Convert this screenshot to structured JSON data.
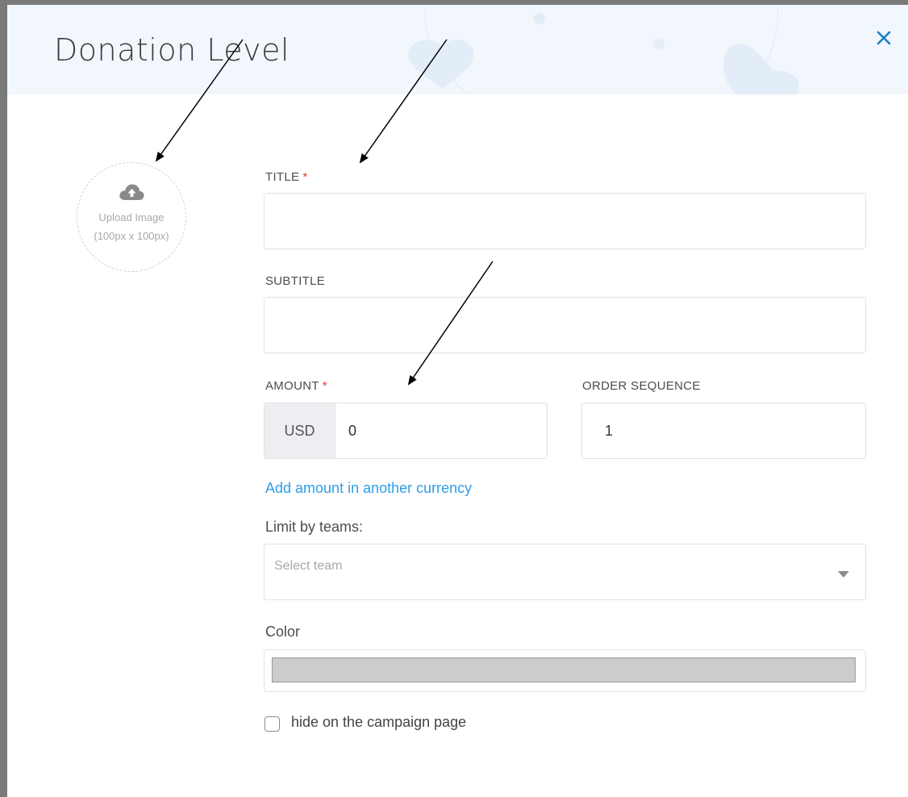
{
  "modal": {
    "title": "Donation Level",
    "close_icon": "close-icon"
  },
  "upload": {
    "icon": "cloud-upload-icon",
    "label": "Upload Image",
    "size_hint": "(100px x 100px)"
  },
  "form": {
    "title": {
      "label": "TITLE",
      "required_mark": "*",
      "value": ""
    },
    "subtitle": {
      "label": "SUBTITLE",
      "value": ""
    },
    "amount": {
      "label": "AMOUNT",
      "required_mark": "*",
      "currency": "USD",
      "value": "0"
    },
    "order_sequence": {
      "label": "ORDER SEQUENCE",
      "value": "1"
    },
    "add_currency_link": "Add amount in another currency",
    "limit_by_teams": {
      "label": "Limit by teams:",
      "placeholder": "Select team",
      "icon": "chevron-down-icon"
    },
    "color": {
      "label": "Color",
      "value": "#cccccc"
    },
    "hide_checkbox": {
      "label": "hide on the campaign page",
      "checked": false
    }
  },
  "colors": {
    "accent": "#2e9ee8",
    "required": "#e53935",
    "header_bg": "#f1f7fc",
    "close": "#1a7fc1"
  }
}
